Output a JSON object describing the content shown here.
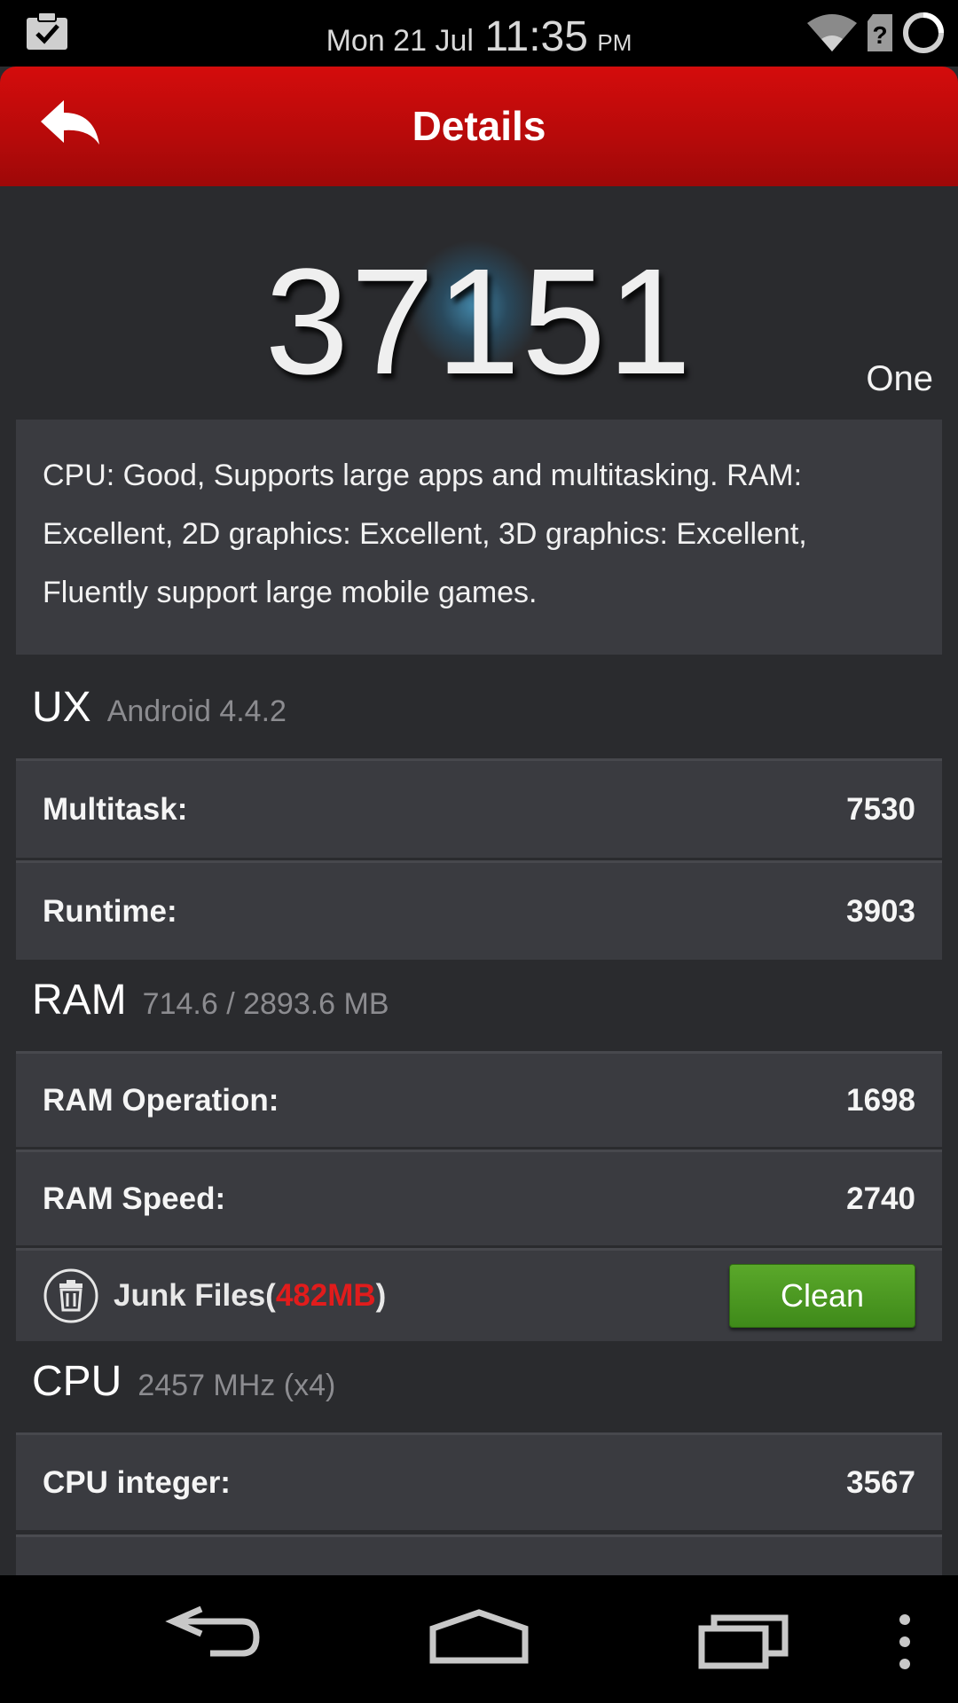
{
  "status_bar": {
    "date": "Mon 21 Jul",
    "time": "11:35",
    "ampm": "PM"
  },
  "action_bar": {
    "title": "Details"
  },
  "score": {
    "value": "37151",
    "device": "One"
  },
  "description": "CPU: Good, Supports large apps and multitasking. RAM: Excellent, 2D graphics: Excellent, 3D graphics: Excellent, Fluently support large mobile games.",
  "sections": {
    "ux": {
      "title": "UX",
      "subtitle": "Android 4.4.2",
      "rows": [
        {
          "label": "Multitask:",
          "value": "7530"
        },
        {
          "label": "Runtime:",
          "value": "3903"
        }
      ]
    },
    "ram": {
      "title": "RAM",
      "subtitle": "714.6 / 2893.6 MB",
      "rows": [
        {
          "label": "RAM Operation:",
          "value": "1698"
        },
        {
          "label": "RAM Speed:",
          "value": "2740"
        }
      ],
      "junk": {
        "label_prefix": "Junk Files(",
        "size": "482MB",
        "label_suffix": ")",
        "clean_label": "Clean"
      }
    },
    "cpu": {
      "title": "CPU",
      "subtitle": "2457 MHz (x4)",
      "rows": [
        {
          "label": "CPU integer:",
          "value": "3567"
        }
      ]
    }
  },
  "colors": {
    "action_bar": "#c40b0b",
    "clean_button": "#4c9a22",
    "junk_size": "#e11c1c",
    "card": "#3a3b40",
    "background": "#2a2b2e"
  },
  "icons": {
    "status_left": "clipboard-check-icon",
    "wifi": "wifi-icon",
    "sim_unknown": "sim-question-icon",
    "battery": "battery-ring-icon",
    "back": "back-arrow-icon",
    "trash": "trash-icon",
    "nav_back": "nav-back-icon",
    "nav_home": "nav-home-icon",
    "nav_recents": "nav-recents-icon",
    "nav_menu": "overflow-menu-icon"
  }
}
